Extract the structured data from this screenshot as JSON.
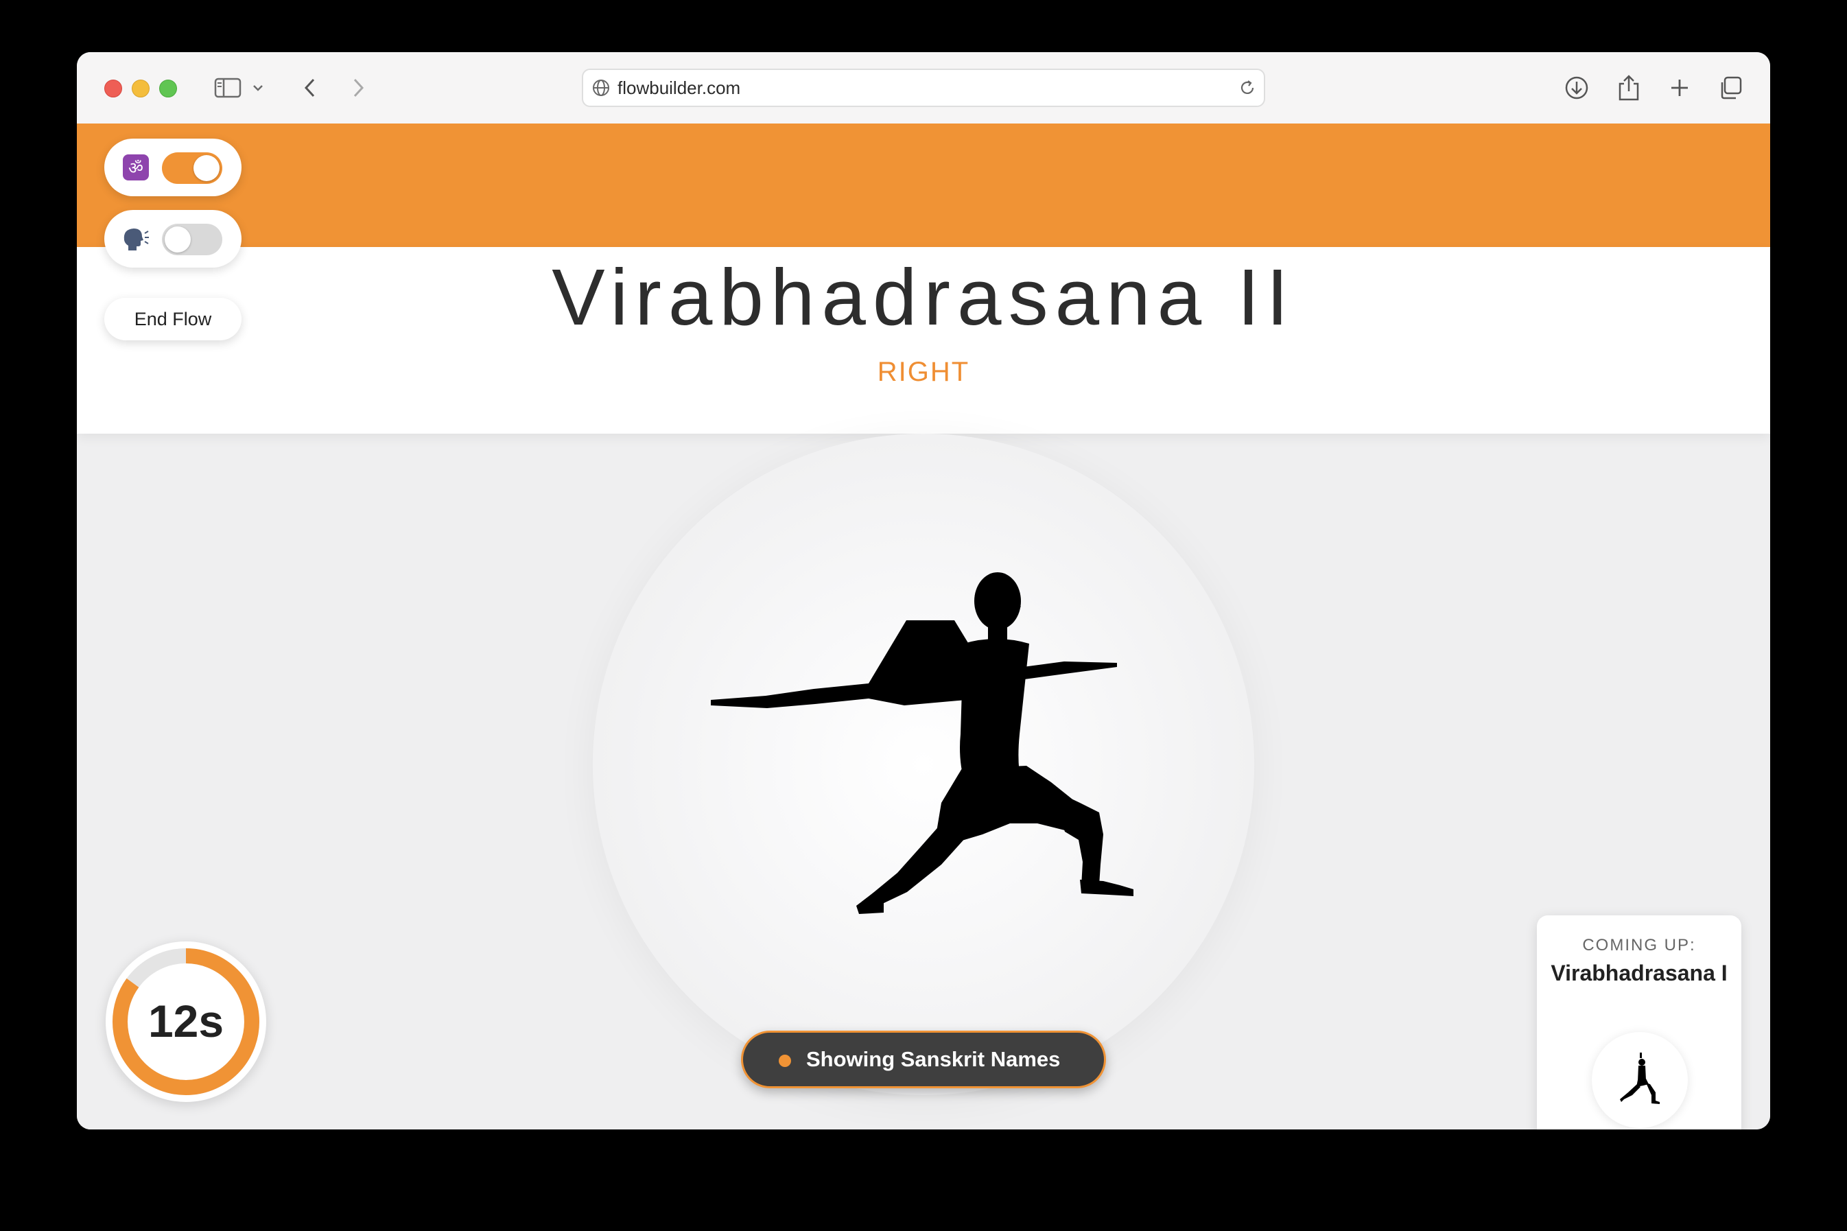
{
  "browser": {
    "url": "flowbuilder.com"
  },
  "controls": {
    "sanskrit_toggle": {
      "icon": "om-icon",
      "on": true
    },
    "voice_toggle": {
      "icon": "speaking-head-icon",
      "on": false
    },
    "end_flow_label": "End Flow"
  },
  "pose": {
    "name": "Virabhadrasana II",
    "side": "RIGHT"
  },
  "timer": {
    "label": "12s",
    "progress_fraction": 0.85
  },
  "indicator": {
    "label": "Showing Sanskrit Names"
  },
  "coming_up": {
    "heading": "COMING UP:",
    "pose_name": "Virabhadrasana I"
  },
  "colors": {
    "accent": "#f09335",
    "pill_dark": "#3f3f3f"
  }
}
